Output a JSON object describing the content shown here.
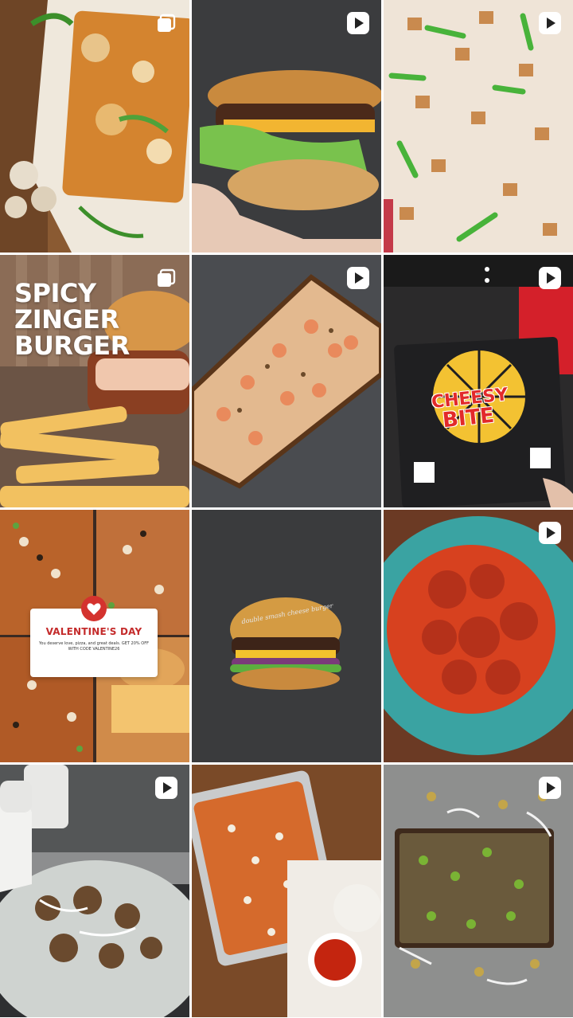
{
  "grid": {
    "posts": [
      {
        "id": 1,
        "subject": "mushroom-pepper-pizza",
        "type": "carousel"
      },
      {
        "id": 2,
        "subject": "cheeseburger-in-hand",
        "type": "reel"
      },
      {
        "id": 3,
        "subject": "raw-chicken-pepper-pizza",
        "type": "reel"
      },
      {
        "id": 4,
        "subject": "spicy-zinger-burger",
        "type": "carousel",
        "title": "SPICY ZINGER BURGER"
      },
      {
        "id": 5,
        "subject": "shrimp-square-pizza",
        "type": "reel"
      },
      {
        "id": 6,
        "subject": "cheesy-bite-pizza-box",
        "type": "reel",
        "brand_line1": "CHEESY",
        "brand_line2": "BITE"
      },
      {
        "id": 7,
        "subject": "valentines-day-promo",
        "type": "collage",
        "title": "VALENTINE'S DAY",
        "body": "You deserve love, pizza, and great deals. GET 20% OFF WITH CODE VALENTINE26"
      },
      {
        "id": 8,
        "subject": "double-cheese-burger",
        "type": "image",
        "caption": "double smash cheese burger"
      },
      {
        "id": 9,
        "subject": "buffalo-wings",
        "type": "reel"
      },
      {
        "id": 10,
        "subject": "sauce-bottle-salad",
        "type": "reel"
      },
      {
        "id": 11,
        "subject": "chicken-tray-with-dips",
        "type": "image"
      },
      {
        "id": 12,
        "subject": "jalapeno-square-pizza",
        "type": "reel"
      }
    ]
  },
  "icons": {
    "reel": "play-badge-icon",
    "carousel": "carousel-badge-icon",
    "heart": "heart-icon"
  },
  "colors": {
    "badge_bg": "#ffffff",
    "badge_fg": "#222222",
    "brand_red": "#e22a2a",
    "promo_red": "#c42b2b"
  }
}
